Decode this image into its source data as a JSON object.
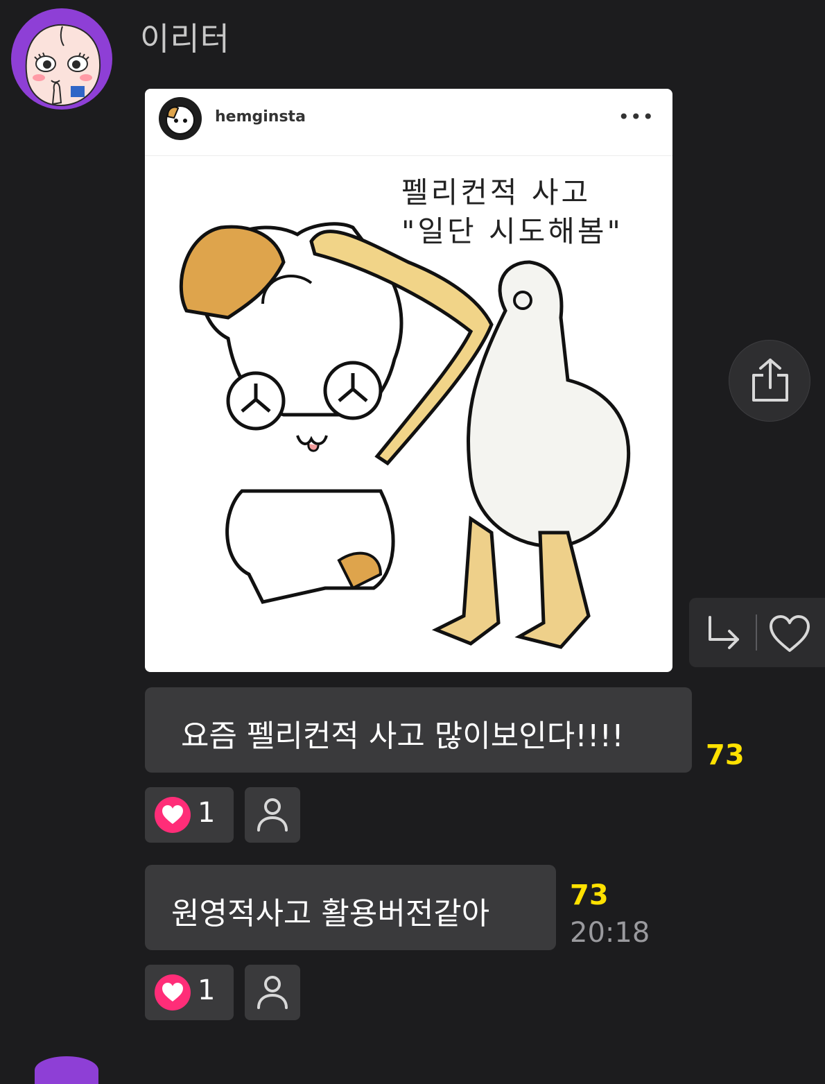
{
  "sender": {
    "name": "이리터"
  },
  "shared_post": {
    "username": "hemginsta",
    "more_label": "•••",
    "image_caption": "펠리컨적 사고\n\"일단 시도해봄\""
  },
  "messages": [
    {
      "text": "요즘 펠리컨적 사고 많이보인다!!!!",
      "unread_count": "73",
      "likes": "1"
    },
    {
      "text": "원영적사고 활용버전같아",
      "unread_count": "73",
      "time": "20:18",
      "likes": "1"
    }
  ],
  "colors": {
    "background": "#1c1c1e",
    "bubble": "#3a3a3c",
    "unread": "#ffe100",
    "like": "#ff2d78",
    "avatar": "#8e3fd6"
  },
  "icons": {
    "share": "share-icon",
    "reply": "reply-icon",
    "like": "heart-icon",
    "user": "person-icon"
  }
}
